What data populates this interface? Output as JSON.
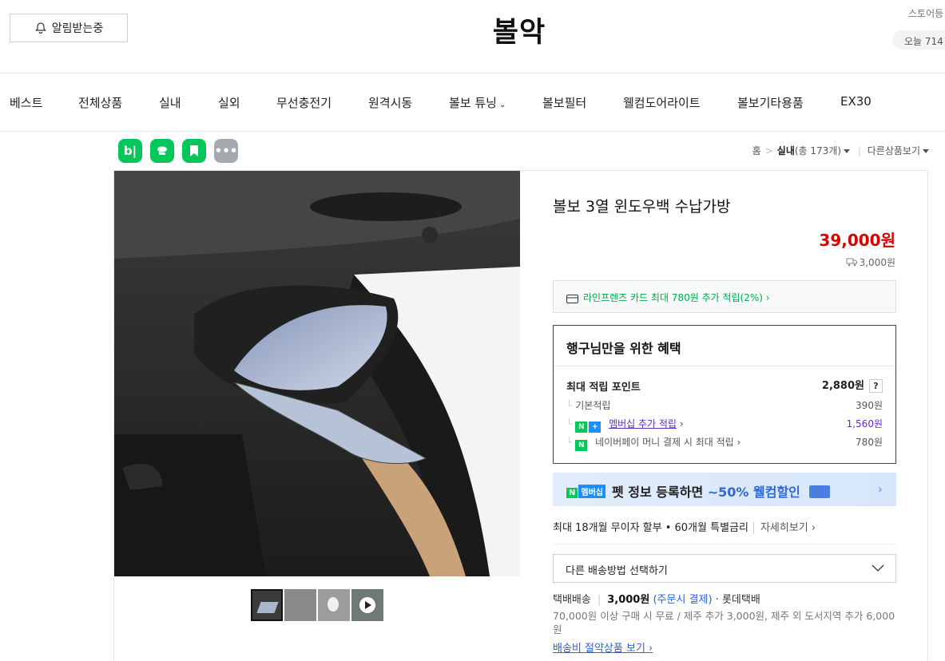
{
  "header": {
    "notify_label": "알림받는중",
    "store_name": "볼악",
    "store_fav_label": "스토어등",
    "today_label": "오늘 714"
  },
  "nav": {
    "items": [
      "베스트",
      "전체상품",
      "실내",
      "실외",
      "무선충전기",
      "원격시동",
      "볼보 튜닝",
      "볼보필터",
      "웰컴도어라이트",
      "볼보기타용품",
      "EX30"
    ]
  },
  "share": {
    "icons": [
      "blog-icon",
      "talk-icon",
      "bookmark-icon",
      "more-icon"
    ]
  },
  "breadcrumb": {
    "home": "홈",
    "category": "실내",
    "count": "(총 173개)",
    "other": "다른상품보기"
  },
  "product": {
    "title": "볼보 3열 윈도우백 수납가방",
    "price": "39,000원",
    "shipping_fee": "3,000원",
    "card_promo": "라인프렌즈 카드 최대 780원 추가 적립(2%)"
  },
  "benefit": {
    "title": "행구님만을 위한 혜택",
    "max_points_label": "최대 적립 포인트",
    "max_points_value": "2,880원",
    "qmark": "?",
    "rows": [
      {
        "label": "기본적립",
        "value": "390원"
      },
      {
        "label": "멤버십 추가 적립",
        "value": "1,560원"
      },
      {
        "label": "네이버페이 머니 결제 시 최대 적립",
        "value": "780원"
      }
    ]
  },
  "promo": {
    "tag1": "N",
    "tag2": "멤버십",
    "text_prefix": "펫 정보 등록하면 ",
    "text_highlight": "~50% 웰컴할인"
  },
  "installment": {
    "text": "최대 18개월 무이자 할부 • 60개월 특별금리",
    "more": "자세히보기"
  },
  "shipping": {
    "select_label": "다른 배송방법 선택하기",
    "method": "택배배송",
    "fee": "3,000원",
    "fee_note": "(주문시 결제)",
    "courier": "롯데택배",
    "note": "70,000원 이상 구매 시 무료 / 제주 추가 3,000원, 제주 외 도서지역 추가 6,000원",
    "link": "배송비 절약상품 보기"
  },
  "colors": {
    "price_red": "#d60000",
    "naver_green": "#03c75a",
    "link_blue": "#2c5fe0"
  }
}
